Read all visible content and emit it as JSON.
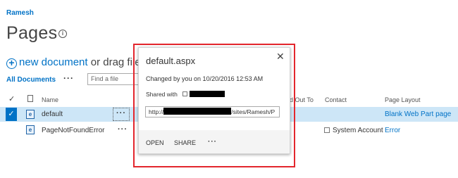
{
  "site": {
    "title": "Ramesh"
  },
  "page": {
    "title": "Pages",
    "info_icon": "info-icon"
  },
  "toolbar": {
    "new_document": "new document",
    "or_drag": "or drag files",
    "view": "All Documents",
    "view_more": "···",
    "search_placeholder": "Find a file"
  },
  "columns": {
    "check": "✓",
    "name": "Name",
    "checked_out_to": "d Out To",
    "contact": "Contact",
    "page_layout": "Page Layout"
  },
  "rows": [
    {
      "name": "default",
      "more": "···",
      "contact": "",
      "layout": "Blank Web Part page",
      "selected": true
    },
    {
      "name": "PageNotFoundError",
      "more": "···",
      "contact": "System Account",
      "layout": "Error",
      "selected": false
    }
  ],
  "callout": {
    "title": "default.aspx",
    "close": "✕",
    "changed": "Changed by you on 10/20/2016 12:53 AM",
    "shared_with": "Shared with",
    "url_prefix": "http://",
    "url_suffix": "/sites/Ramesh/P",
    "open": "OPEN",
    "share": "SHARE",
    "more": "···"
  },
  "colors": {
    "accent": "#0072c6",
    "selected_row": "#cde6f7",
    "highlight_outline": "#e3262d"
  }
}
